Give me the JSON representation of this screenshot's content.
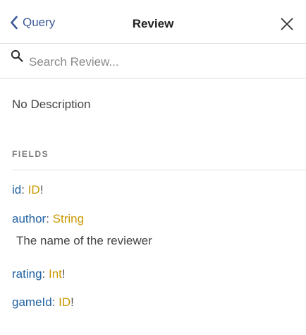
{
  "header": {
    "back_label": "Query",
    "title": "Review",
    "back_icon": "chevron-left-icon",
    "close_icon": "close-icon"
  },
  "search": {
    "placeholder": "Search Review...",
    "value": "",
    "icon": "search-icon"
  },
  "description": "No Description",
  "fields_section": {
    "title": "FIELDS",
    "fields": [
      {
        "name": "id",
        "type": "ID",
        "non_null": "!",
        "description": ""
      },
      {
        "name": "author",
        "type": "String",
        "non_null": "",
        "description": "The name of the reviewer"
      },
      {
        "name": "rating",
        "type": "Int",
        "non_null": "!",
        "description": ""
      },
      {
        "name": "gameId",
        "type": "ID",
        "non_null": "!",
        "description": ""
      }
    ]
  },
  "colors": {
    "field_name": "#1f61a0",
    "type_name": "#ca9800",
    "back_link": "#3d5a99"
  }
}
